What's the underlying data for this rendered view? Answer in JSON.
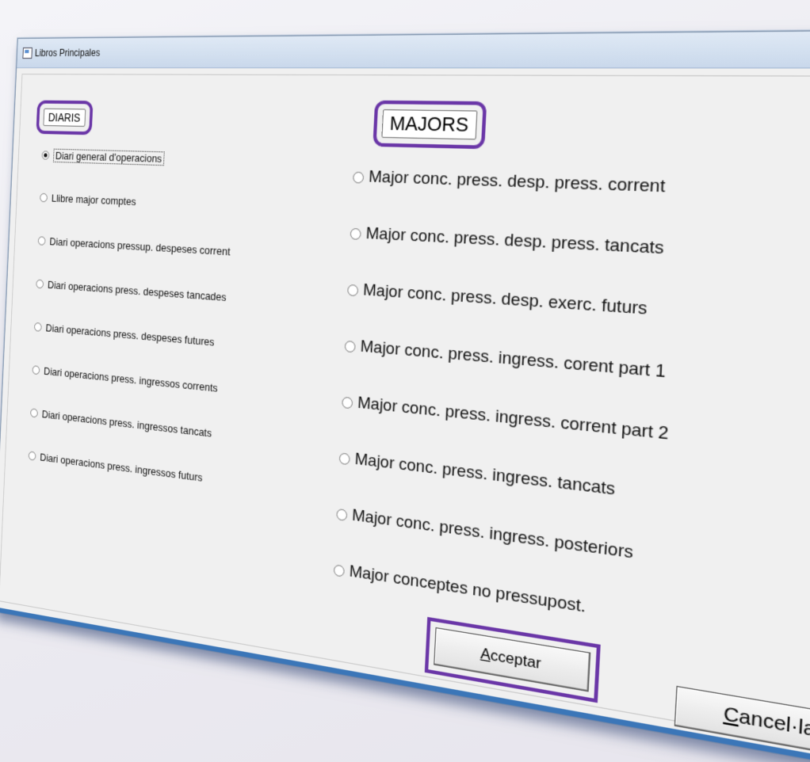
{
  "window": {
    "title": "Libros Principales"
  },
  "diaris": {
    "label": "DIARIS",
    "options": [
      {
        "label": "Diari general d'operacions",
        "checked": true
      },
      {
        "label": "Llibre major comptes",
        "checked": false
      },
      {
        "label": "Diari operacions pressup. despeses corrent",
        "checked": false
      },
      {
        "label": "Diari operacions press. despeses tancades",
        "checked": false
      },
      {
        "label": "Diari operacions press. despeses futures",
        "checked": false
      },
      {
        "label": "Diari operacions press. ingressos corrents",
        "checked": false
      },
      {
        "label": "Diari operacions press. ingressos tancats",
        "checked": false
      },
      {
        "label": "Diari operacions press. ingressos futurs",
        "checked": false
      }
    ]
  },
  "majors": {
    "label": "MAJORS",
    "options": [
      {
        "label": "Major conc. press. desp. press. corrent",
        "checked": false
      },
      {
        "label": "Major conc. press. desp. press. tancats",
        "checked": false
      },
      {
        "label": "Major conc. press. desp. exerc. futurs",
        "checked": false
      },
      {
        "label": "Major conc. press. ingress. corent part 1",
        "checked": false
      },
      {
        "label": "Major conc. press. ingress. corrent part 2",
        "checked": false
      },
      {
        "label": "Major conc. press. ingress. tancats",
        "checked": false
      },
      {
        "label": "Major conc. press. ingress. posteriors",
        "checked": false
      },
      {
        "label": "Major conceptes no pressupost.",
        "checked": false
      }
    ]
  },
  "buttons": {
    "accept": {
      "key": "A",
      "rest": "cceptar"
    },
    "cancel": {
      "key": "C",
      "rest": "ancel·lar"
    }
  },
  "colors": {
    "highlight": "#6a36a7",
    "window_bg": "#f0f0f0",
    "taskbar": "#3b76b8"
  }
}
